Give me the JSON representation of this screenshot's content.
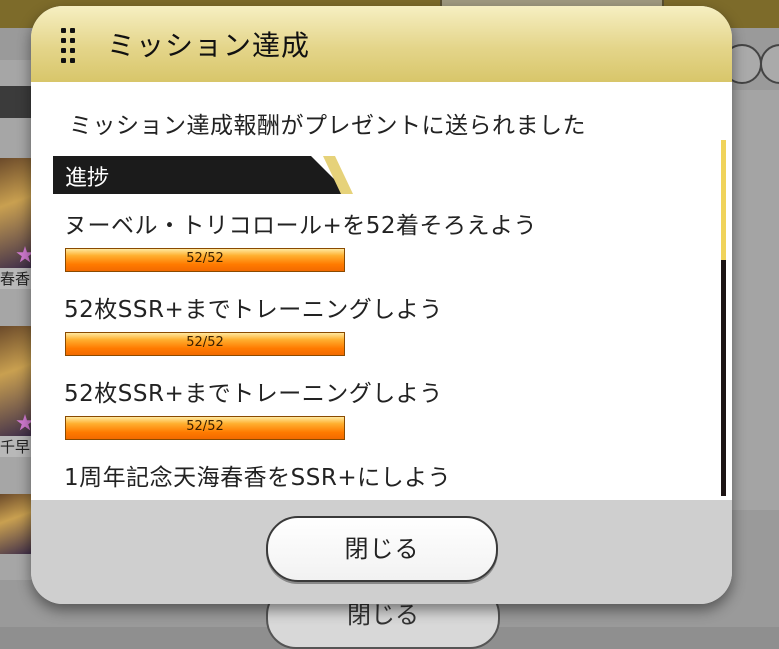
{
  "dialog": {
    "title": "ミッション達成",
    "message": "ミッション達成報酬がプレゼントに送られました",
    "section_label": "進捗",
    "missions": [
      {
        "title": "ヌーベル・トリコロール+を52着そろえよう",
        "progress": "52/52",
        "fraction": 1.0
      },
      {
        "title": "52枚SSR+までトレーニングしよう",
        "progress": "52/52",
        "fraction": 1.0
      },
      {
        "title": "52枚SSR+までトレーニングしよう",
        "progress": "52/52",
        "fraction": 1.0
      },
      {
        "title": "1周年記念天海春香をSSR+にしよう"
      }
    ],
    "close_label": "閉じる"
  },
  "background": {
    "thumb_names": [
      "春香",
      "千早"
    ],
    "close_label": "閉じる"
  }
}
